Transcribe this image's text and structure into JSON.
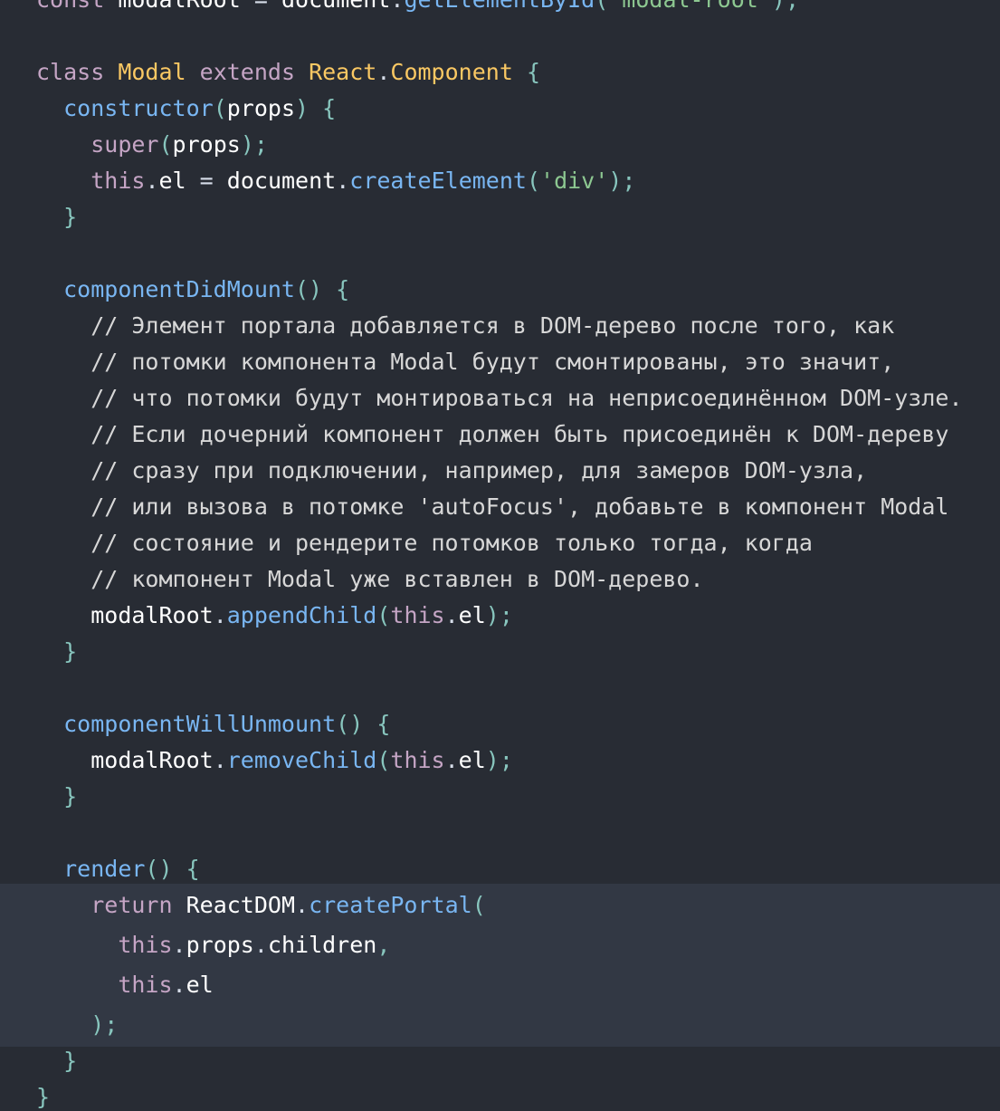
{
  "editor": {
    "colors": {
      "background": "#282c34",
      "highlight": "#323844",
      "keyword": "#c5a5c5",
      "class_name": "#fac863",
      "function": "#79b6f2",
      "string": "#8dc891",
      "comment": "#d7d7d7",
      "punctuation": "#88c6be",
      "identifier": "#ffffff"
    },
    "lines": [
      "const modalRoot = document.getElementById('modal-root');",
      "",
      "class Modal extends React.Component {",
      "  constructor(props) {",
      "    super(props);",
      "    this.el = document.createElement('div');",
      "  }",
      "",
      "  componentDidMount() {",
      "    // Элемент портала добавляется в DOM-дерево после того, как",
      "    // потомки компонента Modal будут смонтированы, это значит,",
      "    // что потомки будут монтироваться на неприсоединённом DOM-узле.",
      "    // Если дочерний компонент должен быть присоединён к DOM-дереву",
      "    // сразу при подключении, например, для замеров DOM-узла,",
      "    // или вызова в потомке 'autoFocus', добавьте в компонент Modal",
      "    // состояние и рендерите потомков только тогда, когда",
      "    // компонент Modal уже вставлен в DOM-дерево.",
      "    modalRoot.appendChild(this.el);",
      "  }",
      "",
      "  componentWillUnmount() {",
      "    modalRoot.removeChild(this.el);",
      "  }",
      "",
      "  render() {",
      "    return ReactDOM.createPortal(",
      "      this.props.children,",
      "      this.el",
      "    );",
      "  }",
      "}"
    ],
    "highlighted_lines": [
      25,
      26,
      27,
      28
    ]
  }
}
